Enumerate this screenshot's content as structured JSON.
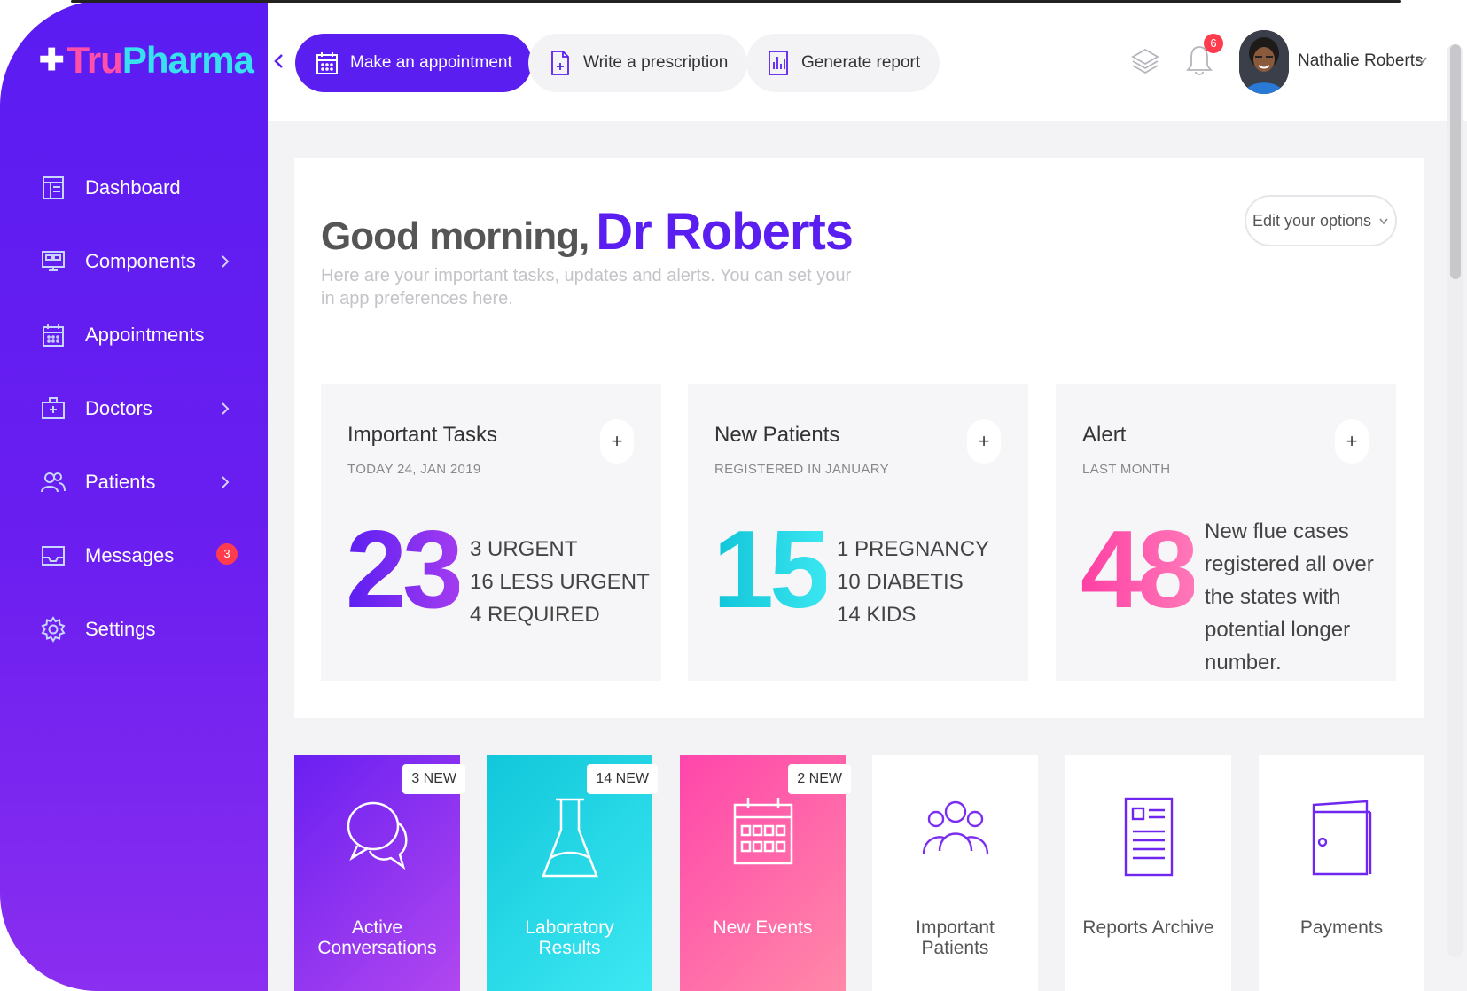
{
  "brand": {
    "cross": "✚",
    "tru": "Tru",
    "pharma": "Pharma"
  },
  "sidebar": {
    "items": [
      {
        "label": "Dashboard",
        "icon": "dashboard-icon",
        "chevron": false,
        "badge": ""
      },
      {
        "label": "Components",
        "icon": "components-icon",
        "chevron": true,
        "badge": ""
      },
      {
        "label": "Appointments",
        "icon": "calendar-icon",
        "chevron": false,
        "badge": ""
      },
      {
        "label": "Doctors",
        "icon": "doctor-bag-icon",
        "chevron": true,
        "badge": ""
      },
      {
        "label": "Patients",
        "icon": "users-icon",
        "chevron": true,
        "badge": ""
      },
      {
        "label": "Messages",
        "icon": "inbox-icon",
        "chevron": false,
        "badge": "3"
      },
      {
        "label": "Settings",
        "icon": "gear-icon",
        "chevron": false,
        "badge": ""
      }
    ]
  },
  "header": {
    "make_appointment": "Make an appointment",
    "write_prescription": "Write a prescription",
    "generate_report": "Generate report",
    "notifications_count": "6",
    "user_name": "Nathalie Roberts"
  },
  "welcome": {
    "greeting": "Good morning,",
    "name": "Dr Roberts",
    "subtitle": "Here are your important tasks, updates and alerts. You can set your in app preferences here.",
    "edit_options": "Edit your options"
  },
  "stats": [
    {
      "title": "Important Tasks",
      "sub": "TODAY 24, JAN 2019",
      "value": "23",
      "lines": [
        "3 URGENT",
        "16 LESS URGENT",
        "4 REQUIRED"
      ]
    },
    {
      "title": "New Patients",
      "sub": "REGISTERED IN JANUARY",
      "value": "15",
      "lines": [
        "1 PREGNANCY",
        "10 DIABETIS",
        "14 KIDS"
      ]
    },
    {
      "title": "Alert",
      "sub": "LAST MONTH",
      "value": "48",
      "text": "New flue cases registered all over the states with potential longer number."
    }
  ],
  "tiles": [
    {
      "label1": "Active",
      "label2": "Conversations",
      "badge": "3 NEW",
      "icon": "chat-bubbles-icon"
    },
    {
      "label1": "Laboratory",
      "label2": "Results",
      "badge": "14 NEW",
      "icon": "flask-icon"
    },
    {
      "label1": "New Events",
      "label2": "",
      "badge": "2 NEW",
      "icon": "calendar-grid-icon"
    },
    {
      "label1": "Important",
      "label2": "Patients",
      "badge": "",
      "icon": "patients-group-icon"
    },
    {
      "label1": "Reports Archive",
      "label2": "",
      "badge": "",
      "icon": "document-icon"
    },
    {
      "label1": "Payments",
      "label2": "",
      "badge": "",
      "icon": "wallet-icon"
    }
  ],
  "colors": {
    "primary": "#5b1ef1",
    "cyan": "#1fd0e4",
    "pink": "#ff4fa8",
    "badge_red": "#ff3b4e"
  }
}
